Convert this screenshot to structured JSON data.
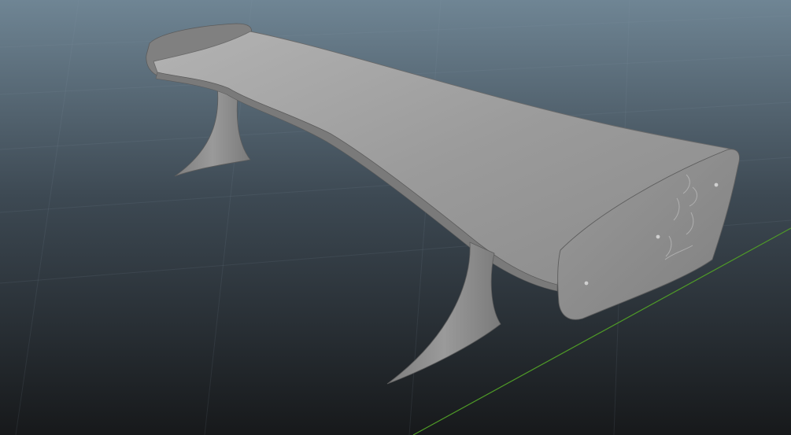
{
  "viewport": {
    "background_top": "#6f8594",
    "background_mid": "#3f4b55",
    "background_bottom": "#181a1c",
    "grid_line_color": "#8a9aa6",
    "axis_line_color": "#4e9a2a"
  },
  "model": {
    "base_color": "#8f8f8f",
    "highlight_color": "#a9a9a9",
    "shadow_color": "#6e6e6e",
    "edge_color": "#5a5a5a"
  }
}
